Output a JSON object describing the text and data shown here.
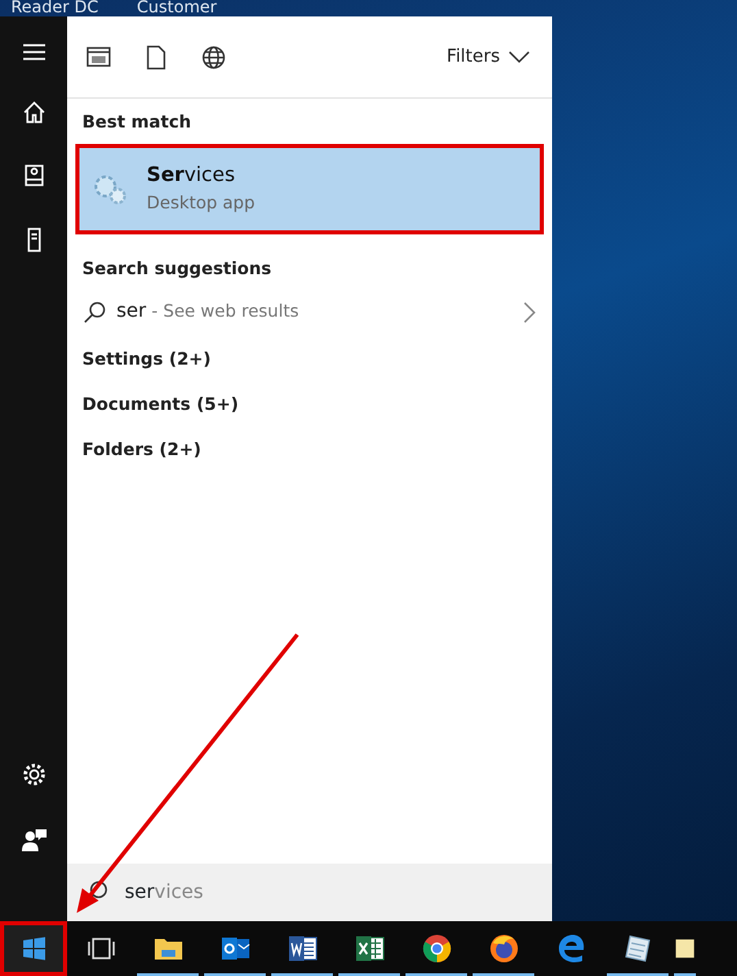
{
  "desktop_icons": [
    {
      "label": "Reader DC"
    },
    {
      "label": "Customer"
    }
  ],
  "sidebar": {
    "top": [
      {
        "kind": "menu"
      },
      {
        "kind": "home"
      },
      {
        "kind": "documents"
      },
      {
        "kind": "device"
      }
    ],
    "bottom": [
      {
        "kind": "settings"
      },
      {
        "kind": "feedback"
      }
    ]
  },
  "toolbar": {
    "scopes": [
      {
        "kind": "apps"
      },
      {
        "kind": "documents"
      },
      {
        "kind": "web"
      }
    ],
    "filters": "Filters"
  },
  "best_match": {
    "heading": "Best match",
    "result": {
      "title": "**Ser**vices",
      "subtitle": "Desktop app",
      "selected": true,
      "highlighted": true
    }
  },
  "suggestions": {
    "heading": "Search suggestions",
    "items": [
      {
        "query": "ser",
        "hint": " - See web results"
      }
    ]
  },
  "categories": [
    {
      "label": "Settings (2+)"
    },
    {
      "label": "Documents (5+)"
    },
    {
      "label": "Folders (2+)"
    }
  ],
  "search": {
    "typed": "ser",
    "completion": "vices"
  },
  "taskbar": [
    {
      "kind": "start",
      "highlighted": true,
      "running": false
    },
    {
      "kind": "taskview",
      "highlighted": false,
      "running": false
    },
    {
      "kind": "explorer",
      "highlighted": false,
      "running": true
    },
    {
      "kind": "outlook",
      "highlighted": false,
      "running": true
    },
    {
      "kind": "word",
      "highlighted": false,
      "running": true
    },
    {
      "kind": "excel",
      "highlighted": false,
      "running": true
    },
    {
      "kind": "chrome",
      "highlighted": false,
      "running": true
    },
    {
      "kind": "firefox",
      "highlighted": false,
      "running": true
    },
    {
      "kind": "edge",
      "highlighted": false,
      "running": false
    },
    {
      "kind": "notepad",
      "highlighted": false,
      "running": true
    },
    {
      "kind": "folder",
      "highlighted": false,
      "running": true
    }
  ]
}
